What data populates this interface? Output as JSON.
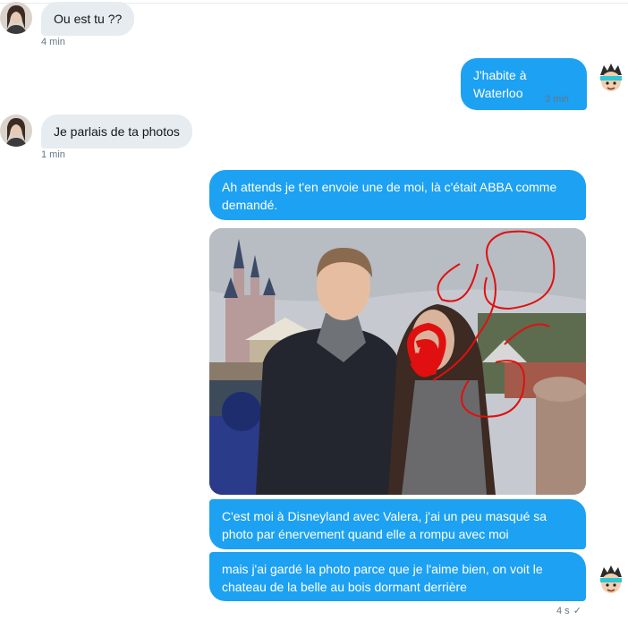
{
  "conversation": {
    "messages": [
      {
        "direction": "in",
        "text": "Ou est tu ??",
        "time": "4 min"
      },
      {
        "direction": "out",
        "text": "J'habite à Waterloo",
        "time": "3 min"
      },
      {
        "direction": "in",
        "text": "Je parlais de ta photos",
        "time": "1 min"
      },
      {
        "direction": "out",
        "text": "Ah attends je t'en envoie une de moi, là c'était ABBA comme demandé."
      },
      {
        "direction": "out",
        "text": "C'est moi à Disneyland avec Valera, j'ai un peu masqué sa photo par énervement quand elle a rompu avec moi"
      },
      {
        "direction": "out",
        "text": "mais j'ai gardé la photo parce que je l'aime bien, on voit le chateau de la belle au bois dormant derrière",
        "time": "4 s"
      }
    ]
  },
  "colors": {
    "incoming_bubble": "#e6ecf0",
    "outgoing_bubble": "#1da1f2",
    "meta_text": "#657786",
    "read_check": "#1da1f2"
  },
  "icons": {
    "read_receipt": "checkmark-icon",
    "photo_scribble": "red-scribble"
  }
}
